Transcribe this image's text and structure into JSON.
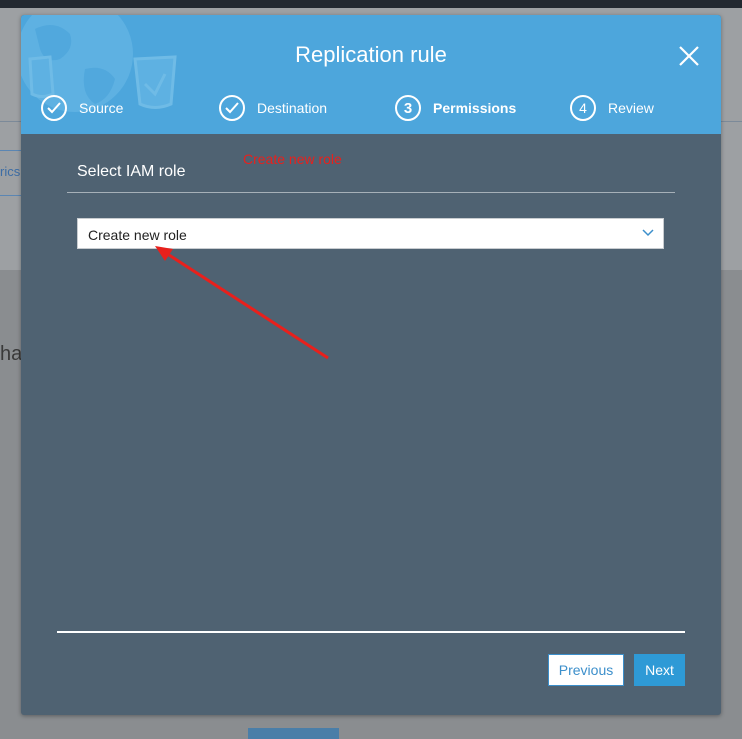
{
  "modal": {
    "title": "Replication rule"
  },
  "steps": [
    {
      "number": "",
      "label": "Source",
      "state": "complete"
    },
    {
      "number": "",
      "label": "Destination",
      "state": "complete"
    },
    {
      "number": "3",
      "label": "Permissions",
      "state": "active"
    },
    {
      "number": "4",
      "label": "Review",
      "state": "upcoming"
    }
  ],
  "permissions": {
    "section_title": "Select IAM role",
    "annotation": "Create new role",
    "role_select_value": "Create new role"
  },
  "footer": {
    "previous_label": "Previous",
    "next_label": "Next"
  },
  "background": {
    "tab_text": "rics",
    "heading_fragment": "ha"
  },
  "colors": {
    "header": "#4da6dc",
    "body": "#4f6272",
    "primary_button": "#2e9ad6",
    "annotation": "#e8201c"
  }
}
